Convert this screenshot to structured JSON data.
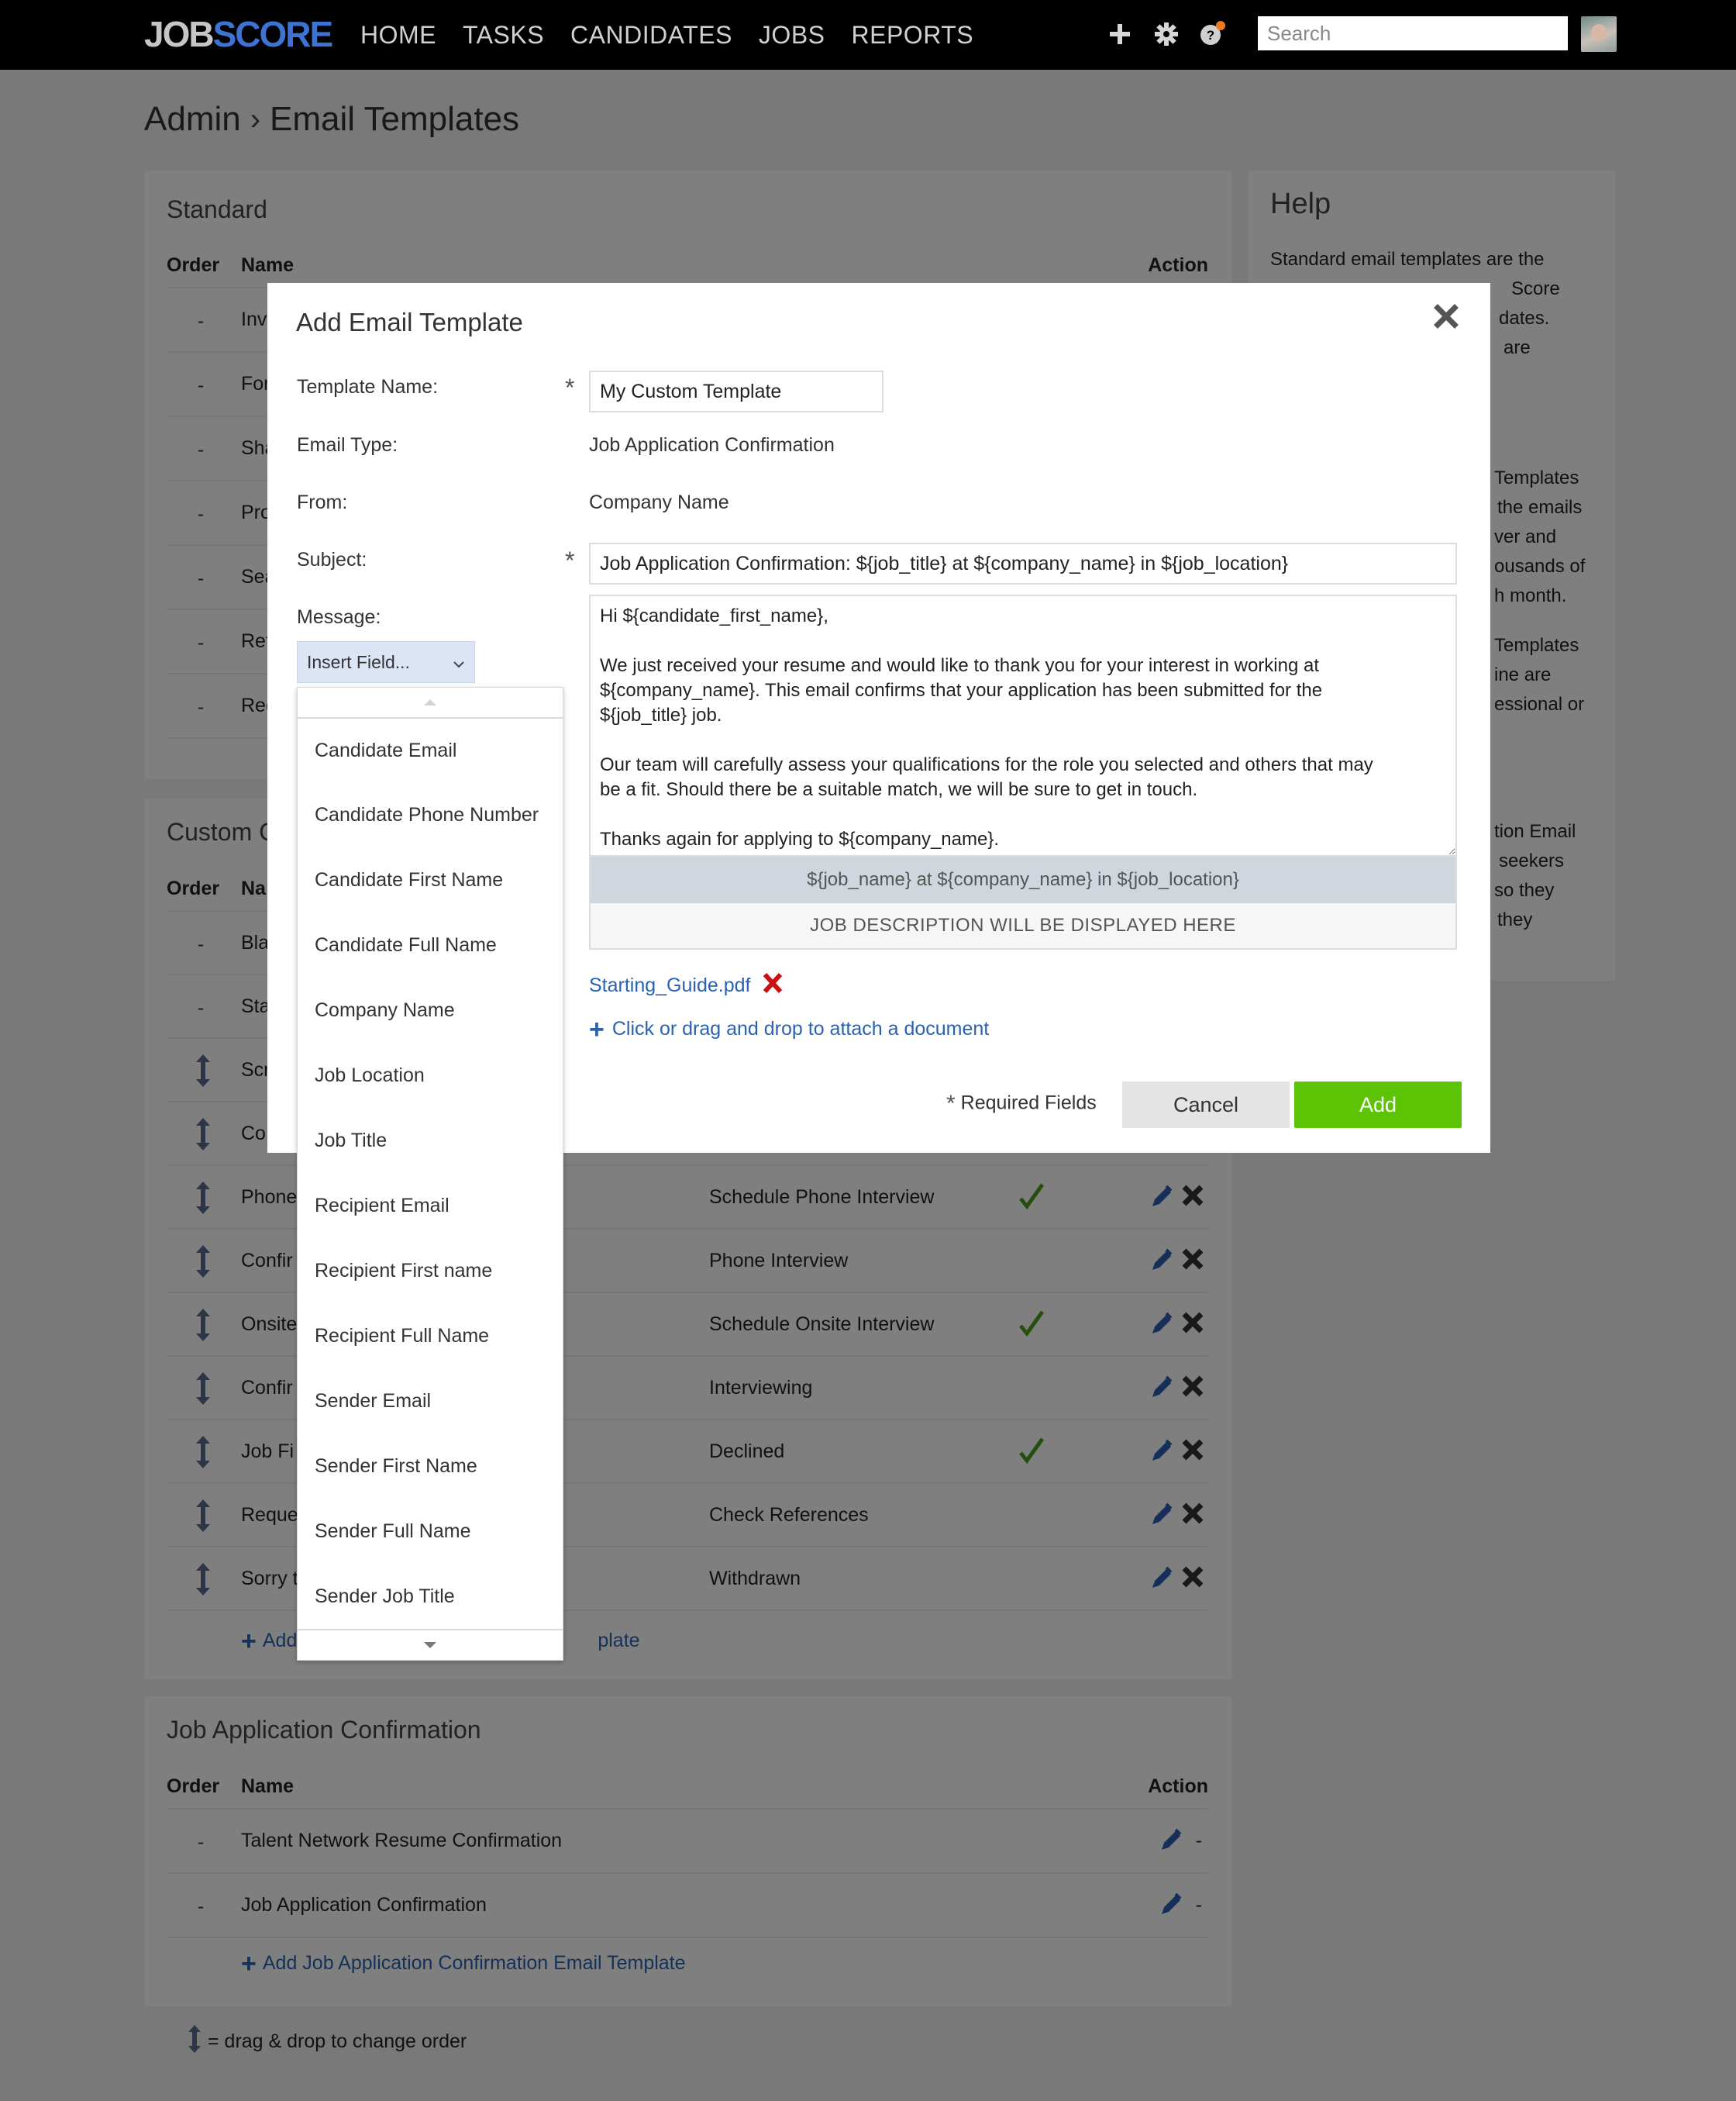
{
  "nav": {
    "logo_part1": "JOB",
    "logo_part2": "SCORE",
    "items": [
      "HOME",
      "TASKS",
      "CANDIDATES",
      "JOBS",
      "REPORTS"
    ],
    "search_placeholder": "Search",
    "icons": [
      "plus-icon",
      "gear-icon",
      "help-icon"
    ],
    "help_badge_color": "#f07a20"
  },
  "breadcrumb": {
    "root": "Admin",
    "separator": "›",
    "current": "Email Templates"
  },
  "standard": {
    "title": "Standard",
    "columns": {
      "order": "Order",
      "name": "Name",
      "action": "Action"
    },
    "rows": [
      {
        "order": "-",
        "name_visible": "Inv"
      },
      {
        "order": "-",
        "name_visible": "For"
      },
      {
        "order": "-",
        "name_visible": "Sha"
      },
      {
        "order": "-",
        "name_visible": "Pro"
      },
      {
        "order": "-",
        "name_visible": "Sea"
      },
      {
        "order": "-",
        "name_visible": "Ref"
      },
      {
        "order": "-",
        "name_visible": "Rec"
      }
    ]
  },
  "custom": {
    "title_visible": "Custom C",
    "columns": {
      "order": "Order",
      "name": "Na"
    },
    "rows": [
      {
        "order": "-",
        "name": "Bla",
        "stage": "",
        "checked": false,
        "draggable": false,
        "actions": false
      },
      {
        "order": "-",
        "name": "Sta",
        "stage": "",
        "checked": false,
        "draggable": false,
        "actions": false
      },
      {
        "order": "drag",
        "name": "Scr",
        "stage": "",
        "checked": false,
        "draggable": true,
        "actions": false
      },
      {
        "order": "drag",
        "name": "Co",
        "stage": "",
        "checked": false,
        "draggable": true,
        "actions": false
      },
      {
        "order": "drag",
        "name": "Phone",
        "stage": "Schedule Phone Interview",
        "checked": true,
        "draggable": true,
        "actions": true
      },
      {
        "order": "drag",
        "name": "Confir",
        "stage": "Phone Interview",
        "checked": false,
        "draggable": true,
        "actions": true
      },
      {
        "order": "drag",
        "name": "Onsite",
        "stage": "Schedule Onsite Interview",
        "checked": true,
        "draggable": true,
        "actions": true
      },
      {
        "order": "drag",
        "name": "Confir",
        "stage": "Interviewing",
        "checked": false,
        "draggable": true,
        "actions": true
      },
      {
        "order": "drag",
        "name": "Job Fi",
        "stage": "Declined",
        "checked": true,
        "draggable": true,
        "actions": true
      },
      {
        "order": "drag",
        "name": "Reque",
        "stage": "Check References",
        "checked": false,
        "draggable": true,
        "actions": true
      },
      {
        "order": "drag",
        "name": "Sorry t",
        "stage": "Withdrawn",
        "checked": false,
        "draggable": true,
        "actions": true
      }
    ],
    "add_link_left": "Add",
    "add_link_right": "plate"
  },
  "jac": {
    "title": "Job Application Confirmation",
    "columns": {
      "order": "Order",
      "name": "Name",
      "action": "Action"
    },
    "rows": [
      {
        "order": "-",
        "name": "Talent Network Resume Confirmation",
        "delete": "-"
      },
      {
        "order": "-",
        "name": "Job Application Confirmation",
        "delete": "-"
      }
    ],
    "add_link": "Add Job Application Confirmation Email Template"
  },
  "legend": {
    "text": "= drag & drop to change order"
  },
  "help": {
    "title": "Help",
    "para1_line1": "Standard email templates are the",
    "para1_line2": "Score",
    "para1_line3": "dates.",
    "para1_line4": "are",
    "para2_line1": "Templates",
    "para2_line2": "the emails",
    "para2_line3": "ver and",
    "para2_line4": "ousands of",
    "para2_line5": "h month.",
    "para3_line1": "Templates",
    "para3_line2": "ine are",
    "para3_line3": "essional or",
    "para4_line1": "tion Email",
    "para4_line2": "seekers",
    "para4_line3": "so they",
    "para4_line4": "they"
  },
  "modal": {
    "title": "Add Email Template",
    "labels": {
      "template_name": "Template Name:",
      "email_type": "Email Type:",
      "from": "From:",
      "subject": "Subject:",
      "message": "Message:"
    },
    "required_mark": "*",
    "template_name_value": "My Custom Template",
    "email_type_value": "Job Application Confirmation",
    "from_value": "Company Name",
    "subject_value": "Job Application Confirmation: ${job_title} at ${company_name} in ${job_location}",
    "message_value": "Hi ${candidate_first_name},\n\nWe just received your resume and would like to thank you for your interest in working at\n${company_name}. This email confirms that your application has been submitted for the\n${job_title} job.\n\nOur team will carefully assess your qualifications for the role you selected and others that may\nbe a fit. Should there be a suitable match, we will be sure to get in touch.\n\nThanks again for applying to ${company_name}.",
    "preview_header": "${job_name} at ${company_name} in ${job_location}",
    "preview_body": "JOB DESCRIPTION WILL BE DISPLAYED HERE",
    "attachment_name": "Starting_Guide.pdf",
    "attach_link": "Click or drag and drop to attach a document",
    "required_note": "Required Fields",
    "cancel_label": "Cancel",
    "add_label": "Add",
    "add_color": "#5cc404",
    "insert_field_label": "Insert Field...",
    "insert_field_options": [
      "Candidate Email",
      "Candidate Phone Number",
      "Candidate First Name",
      "Candidate Full Name",
      "Company Name",
      "Job Location",
      "Job Title",
      "Recipient Email",
      "Recipient First name",
      "Recipient Full Name",
      "Sender Email",
      "Sender First Name",
      "Sender Full Name",
      "Sender Job Title"
    ]
  }
}
